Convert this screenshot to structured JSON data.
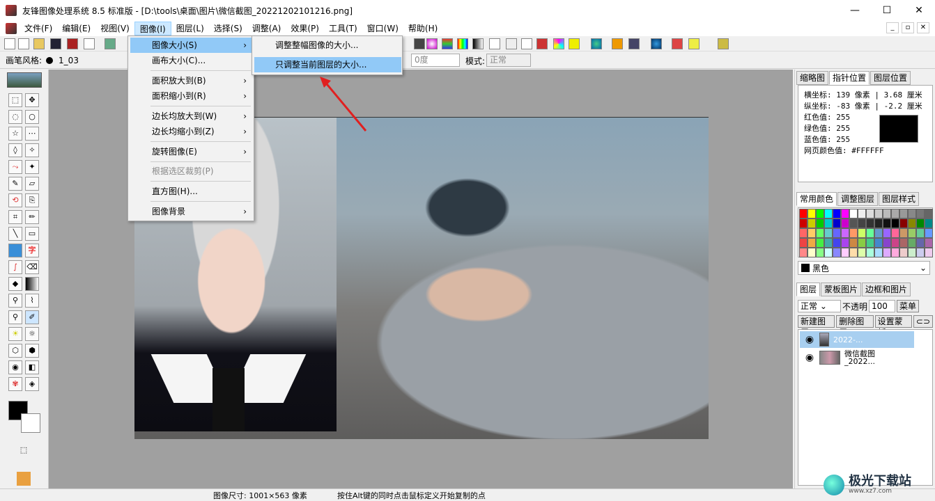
{
  "window": {
    "title": "友锋图像处理系统 8.5 标准版 - [D:\\tools\\桌面\\图片\\微信截图_20221202101216.png]",
    "minimize": "—",
    "maximize": "☐",
    "close": "✕"
  },
  "menubar": {
    "items": [
      "文件(F)",
      "编辑(E)",
      "视图(V)",
      "图像(I)",
      "图层(L)",
      "选择(S)",
      "调整(A)",
      "效果(P)",
      "工具(T)",
      "窗口(W)",
      "帮助(H)"
    ],
    "mdi_min": "_",
    "mdi_restore": "▫",
    "mdi_close": "✕"
  },
  "propbar": {
    "brush_style_label": "画笔风格:",
    "brush_name": "1_03",
    "angle_value": "0度",
    "mode_label": "模式:",
    "mode_value": "正常"
  },
  "image_menu": {
    "items": [
      {
        "label": "图像大小(S)",
        "submenu": true,
        "highlight": true
      },
      {
        "label": "画布大小(C)...",
        "submenu": false
      },
      {
        "label": "面积放大到(B)",
        "submenu": true
      },
      {
        "label": "面积缩小到(R)",
        "submenu": true
      },
      {
        "label": "边长均放大到(W)",
        "submenu": true
      },
      {
        "label": "边长均缩小到(Z)",
        "submenu": true
      },
      {
        "label": "旋转图像(E)",
        "submenu": true
      },
      {
        "label": "根据选区裁剪(P)",
        "submenu": false,
        "disabled": true
      },
      {
        "label": "直方图(H)...",
        "submenu": false
      },
      {
        "label": "图像背景",
        "submenu": true
      }
    ],
    "submenu_arrow": "›"
  },
  "size_submenu": {
    "items": [
      "调整整幅图像的大小...",
      "只调整当前图层的大小..."
    ]
  },
  "right_panel": {
    "top_tabs": [
      "缩略图",
      "指针位置",
      "图层位置"
    ],
    "info": {
      "x_line": "横坐标: 139 像素 | 3.68 厘米",
      "y_line": "纵坐标: -83 像素 | -2.2 厘米",
      "red": "红色值: 255",
      "green": "绿色值: 255",
      "blue": "蓝色值: 255",
      "web": "网页颜色值: #FFFFFF"
    },
    "color_tabs": [
      "常用颜色",
      "调整图层",
      "图层样式"
    ],
    "color_select": "黑色",
    "layer_tabs": [
      "图层",
      "蒙板图片",
      "边框和图片"
    ],
    "blend_mode": "正常",
    "opacity_label": "不透明",
    "opacity_value": "100",
    "menu_btn": "菜单",
    "btn_new": "新建图层",
    "btn_delete": "删除图层",
    "btn_mask": "设置蒙板",
    "layers": [
      {
        "name": "2022-..."
      },
      {
        "name": "微信截图\n_2022..."
      }
    ]
  },
  "statusbar": {
    "size": "图像尺寸: 1001×563 像素",
    "hint": "按住Alt键的同时点击鼠标定义开始复制的点"
  },
  "watermark": {
    "text": "极光下载站",
    "url": "www.xz7.com"
  },
  "colors": {
    "accent_red": "#e02020",
    "menu_highlight": "#91c9f7"
  }
}
